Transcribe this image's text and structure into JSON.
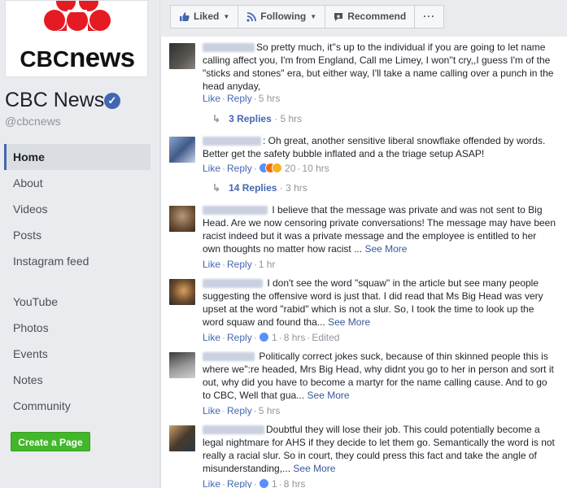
{
  "sidebar": {
    "logo_text_cbc": "CBC",
    "logo_text_news": "news",
    "page_name": "CBC News",
    "handle": "@cbcnews",
    "nav": [
      "Home",
      "About",
      "Videos",
      "Posts",
      "Instagram feed",
      "YouTube",
      "Photos",
      "Events",
      "Notes",
      "Community"
    ],
    "create_page": "Create a Page"
  },
  "action_bar": {
    "liked": "Liked",
    "following": "Following",
    "recommend": "Recommend",
    "more": "···"
  },
  "comments": [
    {
      "text": "So pretty much, it''s up to the individual if you are going to let name calling affect you, I'm from England, Call me Limey, I won''t cry,,I guess I'm of the \"sticks and stones\" era, but either way, I'll take a name calling over a punch in the head anyday,",
      "like": "Like",
      "reply": "Reply",
      "time": "5 hrs",
      "replies_label": "3 Replies",
      "replies_time": "5 hrs"
    },
    {
      "text": ": Oh great, another sensitive liberal snowflake offended by words. Better get the safety bubble inflated and a the triage setup ASAP!",
      "like": "Like",
      "reply": "Reply",
      "reaction_count": "20",
      "time": "10 hrs",
      "replies_label": "14 Replies",
      "replies_time": "3 hrs"
    },
    {
      "text": " I believe that the message was private and was not sent to Big Head. Are we now censoring private conversations! The message may have been racist indeed but it was a private message and the employee is entitled to her own thoughts no matter how racist ...",
      "see_more": "See More",
      "like": "Like",
      "reply": "Reply",
      "time": "1 hr"
    },
    {
      "text": " I don't see the word \"squaw\" in the article but see many people suggesting the offensive word is just that. I did read that Ms Big Head was very upset at the word \"rabid\" which is not a slur. So, I took the time to look up the word squaw and found tha...",
      "see_more": "See More",
      "like": "Like",
      "reply": "Reply",
      "reaction_count": "1",
      "time": "8 hrs",
      "edited": "Edited"
    },
    {
      "text": " Politically correct jokes suck, because of thin skinned people this is where we\":re headed, Mrs Big Head, why didnt you go to her in person and sort it out, why did you have to become a martyr for the name calling cause. And to go to CBC, Well that gua...",
      "see_more": "See More",
      "like": "Like",
      "reply": "Reply",
      "time": "5 hrs"
    },
    {
      "text": "Doubtful they will lose their job. This could potentially become a legal nightmare for AHS if they decide to let them go. Semantically the word is not really a racial slur. So in court, they could press this fact and take the angle of misunderstanding,...",
      "see_more": "See More",
      "like": "Like",
      "reply": "Reply",
      "reaction_count": "1",
      "time": "8 hrs"
    }
  ],
  "colors": {
    "accent": "#4267b2",
    "cbc_red": "#e51b24",
    "create_green": "#42b72a"
  }
}
